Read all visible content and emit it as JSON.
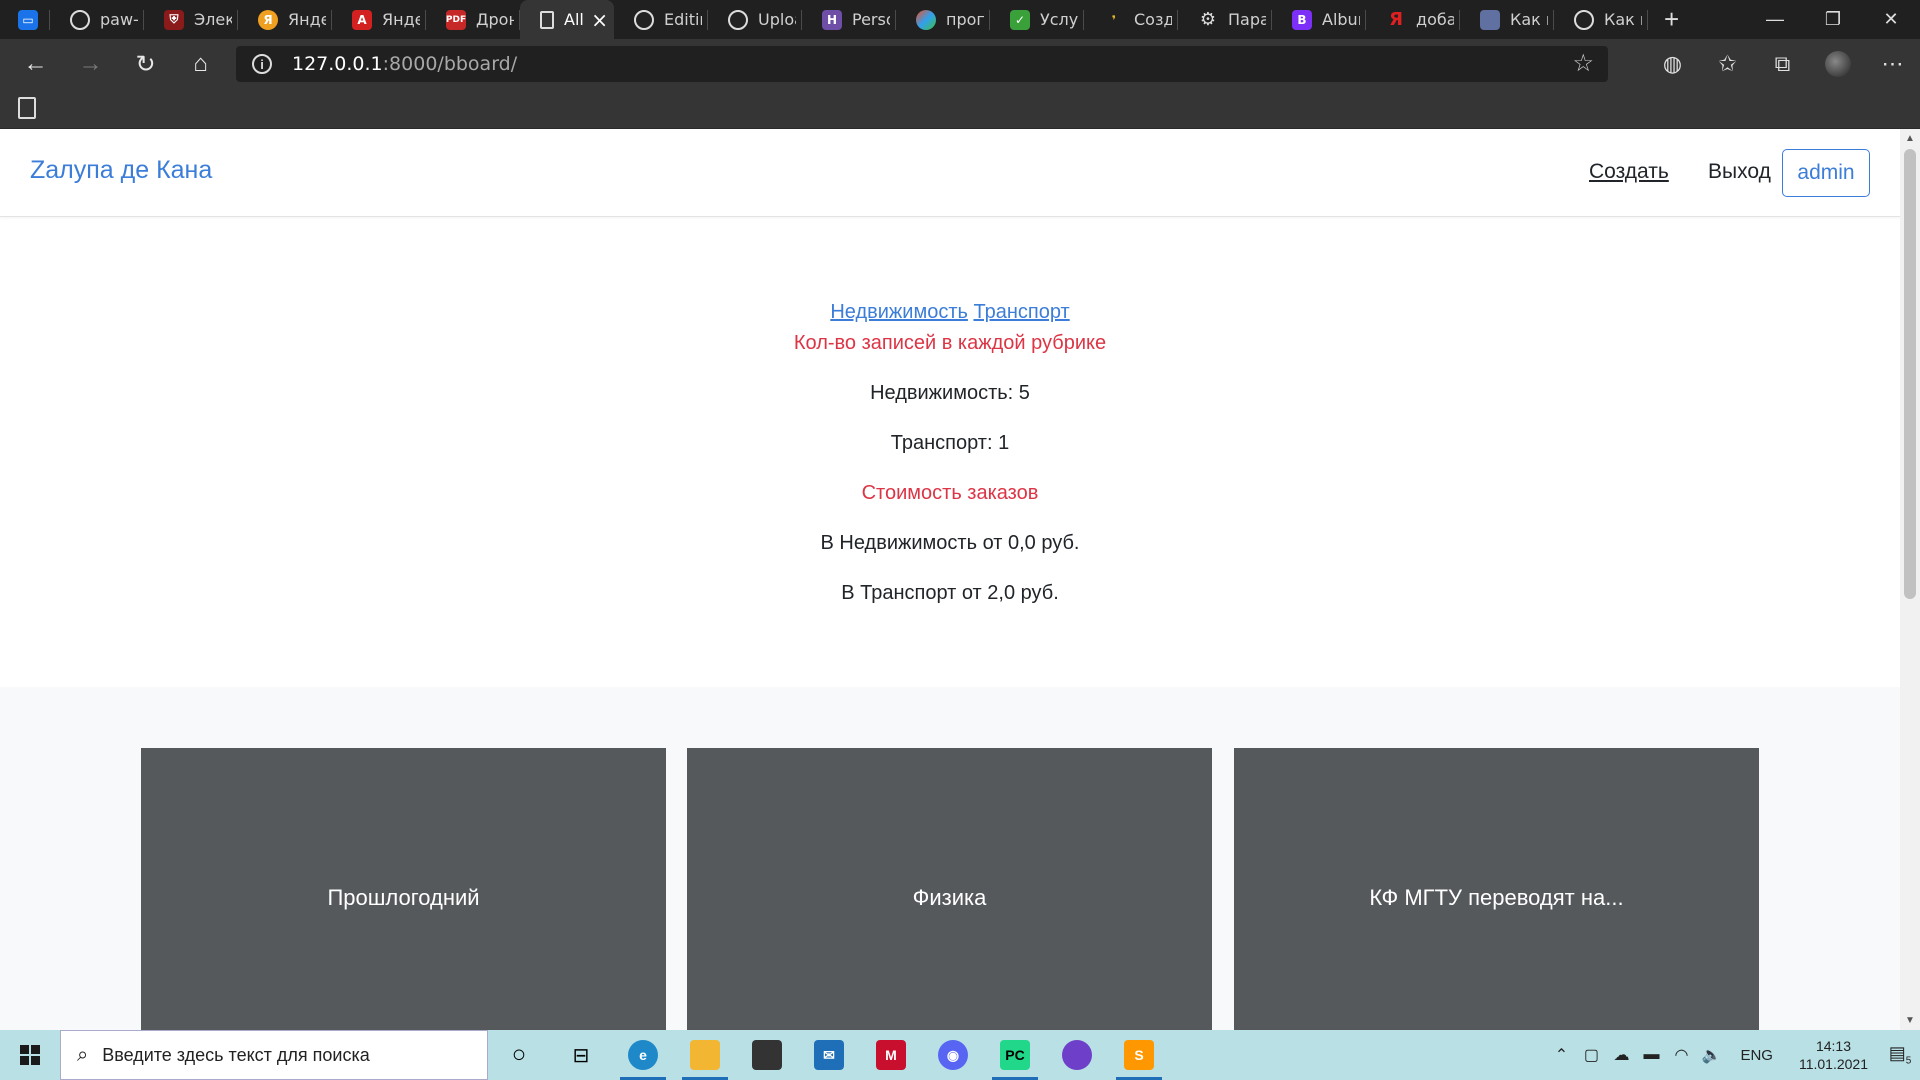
{
  "browser": {
    "tabs": [
      {
        "title": "",
        "favicon": "chat-icon",
        "color": "#1a73e8"
      },
      {
        "title": "paw-w",
        "favicon": "github-icon",
        "color": "#222222"
      },
      {
        "title": "Электр",
        "favicon": "shield-icon",
        "color": "#8b1a1a"
      },
      {
        "title": "Яндекс",
        "favicon": "yandex-icon",
        "color": "#f0a020"
      },
      {
        "title": "Яндекс",
        "favicon": "yandex-red-icon",
        "color": "#d32020"
      },
      {
        "title": "Дроно",
        "favicon": "pdf-icon",
        "color": "#c62828"
      },
      {
        "title": "All",
        "favicon": "page-icon",
        "color": "#353535",
        "active": true
      },
      {
        "title": "Editing",
        "favicon": "github-icon",
        "color": "#222222"
      },
      {
        "title": "Upload",
        "favicon": "github-icon",
        "color": "#222222"
      },
      {
        "title": "Person",
        "favicon": "heroku-icon",
        "color": "#6f4ea8"
      },
      {
        "title": "програ",
        "favicon": "dots-icon",
        "color": "#f05020"
      },
      {
        "title": "Услуги",
        "favicon": "leaf-icon",
        "color": "#3aa03a"
      },
      {
        "title": "Создат",
        "favicon": "yandex-bar-icon",
        "color": "#f0c020"
      },
      {
        "title": "Парам",
        "favicon": "gear-icon",
        "color": "#555555"
      },
      {
        "title": "Album",
        "favicon": "bootstrap-icon",
        "color": "#7b2ff7"
      },
      {
        "title": "добав",
        "favicon": "yandex-letter-icon",
        "color": "#e02020"
      },
      {
        "title": "Как вс",
        "favicon": "app-icon",
        "color": "#6070a0"
      },
      {
        "title": "Как вс",
        "favicon": "github-icon",
        "color": "#222222"
      }
    ],
    "url_host": "127.0.0.1",
    "url_rest": ":8000/bboard/"
  },
  "site": {
    "brand": "Zалупа де Кана",
    "nav_create": "Создать",
    "nav_logout": "Выход",
    "user_button": "admin",
    "rubric_links": [
      "Недвижимость",
      "Транспорт"
    ],
    "count_heading": "Кол-во записей в каждой рубрике",
    "counts": [
      "Недвижимость: 5",
      "Транспорт: 1"
    ],
    "price_heading": "Стоимость заказов",
    "prices": [
      "В Недвижимость от 0,0 руб.",
      "В Транспорт от 2,0 руб."
    ],
    "cards": [
      "Прошлогодний",
      "Физика",
      "КФ МГТУ переводят на..."
    ]
  },
  "taskbar": {
    "search_placeholder": "Введите здесь текст для поиска",
    "apps": [
      {
        "name": "cortana-icon",
        "running": false
      },
      {
        "name": "task-view-icon",
        "running": false
      },
      {
        "name": "edge-icon",
        "running": true,
        "color": "#1e88c8"
      },
      {
        "name": "file-explorer-icon",
        "running": true,
        "color": "#f2b632"
      },
      {
        "name": "store-icon",
        "running": false,
        "color": "#333333"
      },
      {
        "name": "mail-icon",
        "running": false,
        "color": "#1e6fb8"
      },
      {
        "name": "mcafee-icon",
        "running": false,
        "color": "#c8102e"
      },
      {
        "name": "discord-icon",
        "running": false,
        "color": "#5865f2"
      },
      {
        "name": "pycharm-icon",
        "running": true,
        "color": "#21d789"
      },
      {
        "name": "github-desktop-icon",
        "running": false,
        "color": "#6e40c9"
      },
      {
        "name": "sublime-icon",
        "running": true,
        "color": "#ff9800"
      }
    ],
    "language": "ENG",
    "time": "14:13",
    "date": "11.01.2021",
    "notification_count": "5"
  }
}
